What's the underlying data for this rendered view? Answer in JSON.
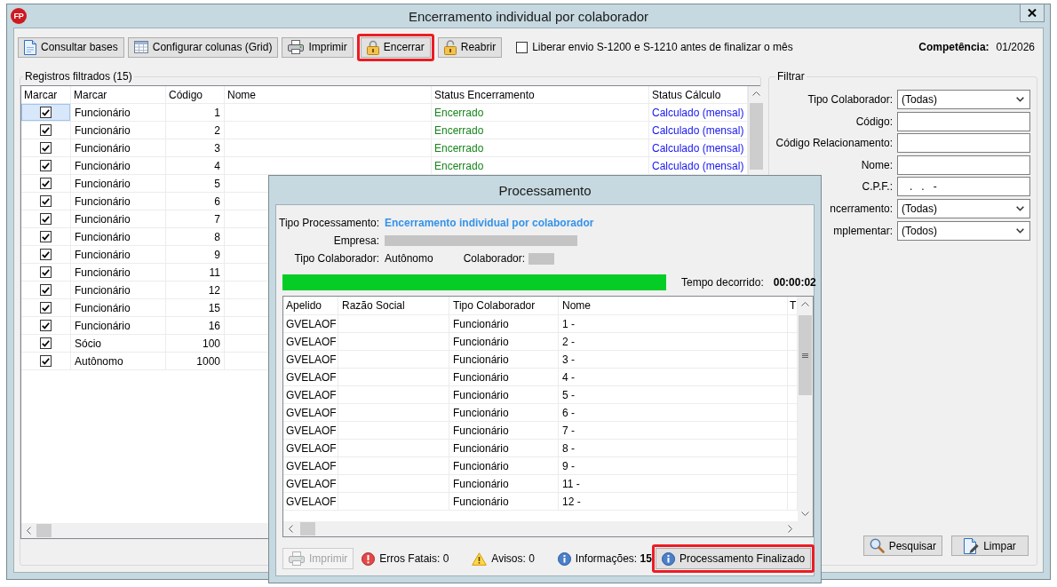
{
  "window": {
    "logo": "FP",
    "title": "Encerramento individual por colaborador"
  },
  "toolbar": {
    "buttons": [
      {
        "kind": "query",
        "label": "Consultar bases",
        "highlighted": false
      },
      {
        "kind": "columns",
        "label": "Configurar colunas (Grid)",
        "highlighted": false
      },
      {
        "kind": "print",
        "label": "Imprimir",
        "highlighted": false
      },
      {
        "kind": "lock",
        "label": "Encerrar",
        "highlighted": true
      },
      {
        "kind": "unlock",
        "label": "Reabrir",
        "highlighted": false
      }
    ],
    "option": {
      "label": "Liberar envio S-1200 e S-1210 antes de finalizar o mês",
      "checked": false
    },
    "competencia": {
      "label": "Competência:",
      "value": "01/2026"
    }
  },
  "records": {
    "title": "Registros filtrados (15)",
    "columns": [
      "Marcar",
      "Marcar",
      "Código",
      "Nome",
      "Status Encerramento",
      "Status Cálculo"
    ],
    "rows": [
      {
        "checked": true,
        "selected": true,
        "tipo": "Funcionário",
        "codigo": "1",
        "status_encerramento": "Encerrado",
        "status_calculo": "Calculado (mensal)"
      },
      {
        "checked": true,
        "selected": false,
        "tipo": "Funcionário",
        "codigo": "2",
        "status_encerramento": "Encerrado",
        "status_calculo": "Calculado (mensal)"
      },
      {
        "checked": true,
        "selected": false,
        "tipo": "Funcionário",
        "codigo": "3",
        "status_encerramento": "Encerrado",
        "status_calculo": "Calculado (mensal)"
      },
      {
        "checked": true,
        "selected": false,
        "tipo": "Funcionário",
        "codigo": "4",
        "status_encerramento": "Encerrado",
        "status_calculo": "Calculado (mensal)"
      },
      {
        "checked": true,
        "selected": false,
        "tipo": "Funcionário",
        "codigo": "5"
      },
      {
        "checked": true,
        "selected": false,
        "tipo": "Funcionário",
        "codigo": "6"
      },
      {
        "checked": true,
        "selected": false,
        "tipo": "Funcionário",
        "codigo": "7"
      },
      {
        "checked": true,
        "selected": false,
        "tipo": "Funcionário",
        "codigo": "8"
      },
      {
        "checked": true,
        "selected": false,
        "tipo": "Funcionário",
        "codigo": "9"
      },
      {
        "checked": true,
        "selected": false,
        "tipo": "Funcionário",
        "codigo": "11"
      },
      {
        "checked": true,
        "selected": false,
        "tipo": "Funcionário",
        "codigo": "12"
      },
      {
        "checked": true,
        "selected": false,
        "tipo": "Funcionário",
        "codigo": "15"
      },
      {
        "checked": true,
        "selected": false,
        "tipo": "Funcionário",
        "codigo": "16"
      },
      {
        "checked": true,
        "selected": false,
        "tipo": "Sócio",
        "codigo": "100"
      },
      {
        "checked": true,
        "selected": false,
        "tipo": "Autônomo",
        "codigo": "1000"
      }
    ]
  },
  "filter": {
    "title": "Filtrar",
    "fields": [
      {
        "kind": "select",
        "label": "Tipo Colaborador:",
        "value": "(Todas)"
      },
      {
        "kind": "text",
        "label": "Código:"
      },
      {
        "kind": "text",
        "label": "Código Relacionamento:"
      },
      {
        "kind": "text",
        "label": "Nome:"
      },
      {
        "kind": "text",
        "label": "C.P.F.:",
        "value": "   .   .   -"
      },
      {
        "kind": "select",
        "label": "ncerramento:",
        "value": "(Todas)"
      },
      {
        "kind": "select",
        "label": "mplementar:",
        "value": "(Todos)"
      }
    ],
    "buttons": [
      {
        "kind": "search",
        "label": "Pesquisar"
      },
      {
        "kind": "clear",
        "label": "Limpar"
      }
    ]
  },
  "dialog": {
    "title": "Processamento",
    "tipo_processamento": {
      "label": "Tipo Processamento:",
      "value": "Encerramento individual por colaborador"
    },
    "empresa": {
      "label": "Empresa:",
      "redacted": true
    },
    "tipo_colaborador": {
      "label": "Tipo Colaborador:",
      "value": "Autônomo"
    },
    "colaborador": {
      "label": "Colaborador:",
      "redacted": true
    },
    "progress": {
      "level": 1
    },
    "elapsed": {
      "label": "Tempo decorrido:",
      "value": "00:00:02"
    },
    "log": {
      "columns": [
        "Apelido",
        "Razão Social",
        "Tipo Colaborador",
        "Nome",
        "T"
      ],
      "rows": [
        {
          "apelido": "GVELAOF",
          "tipo": "Funcionário",
          "nome": "1 -"
        },
        {
          "apelido": "GVELAOF",
          "tipo": "Funcionário",
          "nome": "2 -"
        },
        {
          "apelido": "GVELAOF",
          "tipo": "Funcionário",
          "nome": "3 -"
        },
        {
          "apelido": "GVELAOF",
          "tipo": "Funcionário",
          "nome": "4 -"
        },
        {
          "apelido": "GVELAOF",
          "tipo": "Funcionário",
          "nome": "5 -"
        },
        {
          "apelido": "GVELAOF",
          "tipo": "Funcionário",
          "nome": "6 -"
        },
        {
          "apelido": "GVELAOF",
          "tipo": "Funcionário",
          "nome": "7 -"
        },
        {
          "apelido": "GVELAOF",
          "tipo": "Funcionário",
          "nome": "8 -"
        },
        {
          "apelido": "GVELAOF",
          "tipo": "Funcionário",
          "nome": "9 -"
        },
        {
          "apelido": "GVELAOF",
          "tipo": "Funcionário",
          "nome": "11 -"
        },
        {
          "apelido": "GVELAOF",
          "tipo": "Funcionário",
          "nome": "12 -"
        }
      ]
    },
    "footer": {
      "print_button": {
        "label": "Imprimir",
        "disabled": true
      },
      "counters": [
        {
          "kind": "error",
          "text": "Erros Fatais: 0"
        },
        {
          "kind": "warning",
          "text": "Avisos: 0"
        },
        {
          "kind": "info",
          "text": "Informações: **15**"
        }
      ],
      "status_button": {
        "label": "Processamento Finalizado",
        "highlighted": true
      }
    }
  }
}
